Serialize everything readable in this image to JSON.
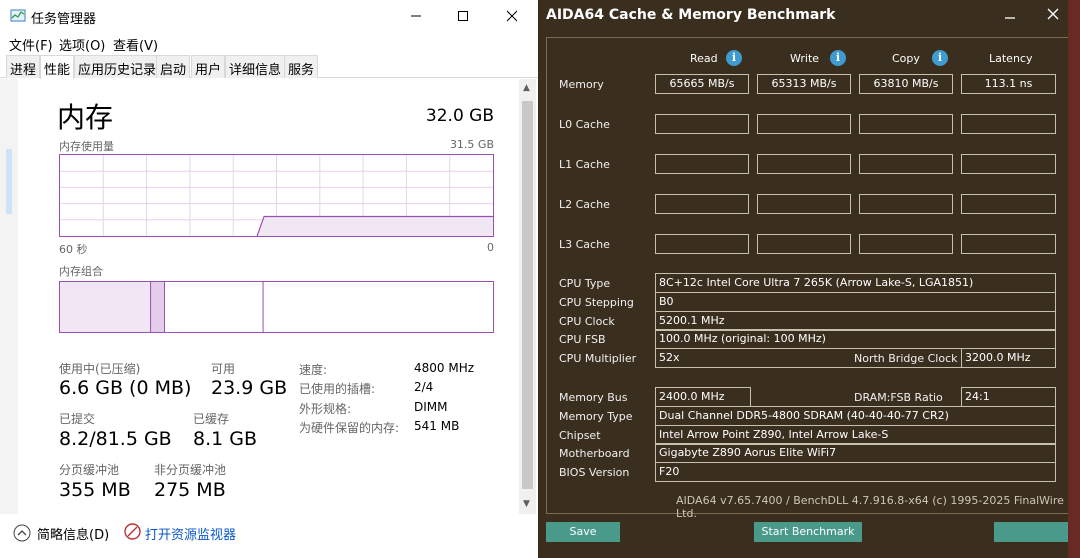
{
  "task_manager": {
    "window_title": "任务管理器",
    "menu": [
      "文件(F)",
      "选项(O)",
      "查看(V)"
    ],
    "tabs": [
      "进程",
      "性能",
      "应用历史记录",
      "启动",
      "用户",
      "详细信息",
      "服务"
    ],
    "heading": "内存",
    "total": "32.0 GB",
    "usage_label": "内存使用量",
    "usage_max": "31.5 GB",
    "time_left": "60 秒",
    "time_right": "0",
    "composition_label": "内存组合",
    "in_use_label": "使用中(已压缩)",
    "in_use_value": "6.6 GB (0 MB)",
    "available_label": "可用",
    "available_value": "23.9 GB",
    "committed_label": "已提交",
    "committed_value": "8.2/81.5 GB",
    "cached_label": "已缓存",
    "cached_value": "8.1 GB",
    "paged_label": "分页缓冲池",
    "paged_value": "355 MB",
    "nonpaged_label": "非分页缓冲池",
    "nonpaged_value": "275 MB",
    "specs": [
      {
        "key": "速度:",
        "value": "4800 MHz"
      },
      {
        "key": "已使用的插槽:",
        "value": "2/4"
      },
      {
        "key": "外形规格:",
        "value": "DIMM"
      },
      {
        "key": "为硬件保留的内存:",
        "value": "541 MB"
      }
    ],
    "footer_brief": "简略信息(D)",
    "footer_link": "打开资源监视器",
    "accent": "#9b4fb0"
  },
  "aida": {
    "title": "AIDA64 Cache & Memory Benchmark",
    "columns": [
      "Read",
      "Write",
      "Copy",
      "Latency"
    ],
    "rows": [
      {
        "label": "Memory",
        "values": [
          "65665 MB/s",
          "65313 MB/s",
          "63810 MB/s",
          "113.1 ns"
        ]
      },
      {
        "label": "L0 Cache",
        "values": [
          "",
          "",
          "",
          ""
        ]
      },
      {
        "label": "L1 Cache",
        "values": [
          "",
          "",
          "",
          ""
        ]
      },
      {
        "label": "L2 Cache",
        "values": [
          "",
          "",
          "",
          ""
        ]
      },
      {
        "label": "L3 Cache",
        "values": [
          "",
          "",
          "",
          ""
        ]
      }
    ],
    "cpu_type_label": "CPU Type",
    "cpu_type": "8C+12c Intel Core Ultra 7 265K  (Arrow Lake-S, LGA1851)",
    "cpu_stepping_label": "CPU Stepping",
    "cpu_stepping": "B0",
    "cpu_clock_label": "CPU Clock",
    "cpu_clock": "5200.1 MHz",
    "cpu_fsb_label": "CPU FSB",
    "cpu_fsb": "100.0 MHz  (original: 100 MHz)",
    "cpu_multiplier_label": "CPU Multiplier",
    "cpu_multiplier": "52x",
    "nb_clock_label": "North Bridge Clock",
    "nb_clock": "3200.0 MHz",
    "memory_bus_label": "Memory Bus",
    "memory_bus": "2400.0 MHz",
    "dram_fsb_label": "DRAM:FSB Ratio",
    "dram_fsb": "24:1",
    "memory_type_label": "Memory Type",
    "memory_type": "Dual Channel DDR5-4800 SDRAM  (40-40-40-77 CR2)",
    "chipset_label": "Chipset",
    "chipset": "Intel Arrow Point Z890, Intel Arrow Lake-S",
    "motherboard_label": "Motherboard",
    "motherboard": "Gigabyte Z890 Aorus Elite WiFi7",
    "bios_label": "BIOS Version",
    "bios": "F20",
    "footer": "AIDA64 v7.65.7400 / BenchDLL 4.7.916.8-x64  (c) 1995-2025 FinalWire Ltd.",
    "save_label": "Save",
    "start_label": "Start Benchmark",
    "bg_color": "#3a2e1f",
    "button_color": "#4a9a8c"
  }
}
